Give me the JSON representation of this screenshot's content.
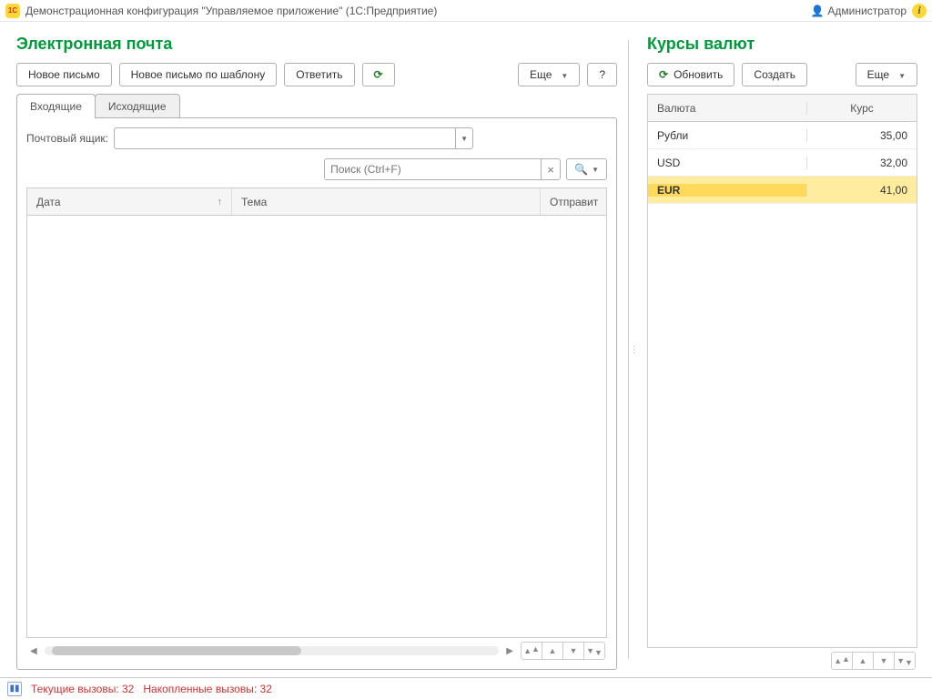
{
  "titlebar": {
    "logo_text": "1C",
    "title": "Демонстрационная конфигурация \"Управляемое приложение\"  (1С:Предприятие)",
    "user": "Администратор",
    "info_glyph": "i"
  },
  "email": {
    "heading": "Электронная почта",
    "toolbar": {
      "new_msg": "Новое письмо",
      "new_by_template": "Новое письмо по шаблону",
      "reply": "Ответить",
      "more": "Еще",
      "help": "?"
    },
    "tabs": {
      "inbox": "Входящие",
      "outbox": "Исходящие"
    },
    "mailbox_label": "Почтовый ящик:",
    "search_placeholder": "Поиск (Ctrl+F)",
    "columns": {
      "date": "Дата",
      "subject": "Тема",
      "sender": "Отправит"
    }
  },
  "rates": {
    "heading": "Курсы валют",
    "toolbar": {
      "refresh": "Обновить",
      "create": "Создать",
      "more": "Еще"
    },
    "columns": {
      "currency": "Валюта",
      "rate": "Курс"
    },
    "rows": [
      {
        "currency": "Рубли",
        "rate": "35,00"
      },
      {
        "currency": "USD",
        "rate": "32,00"
      },
      {
        "currency": "EUR",
        "rate": "41,00"
      }
    ],
    "selected_index": 2
  },
  "status": {
    "current": "Текущие вызовы: 32",
    "accumulated": "Накопленные вызовы: 32"
  }
}
